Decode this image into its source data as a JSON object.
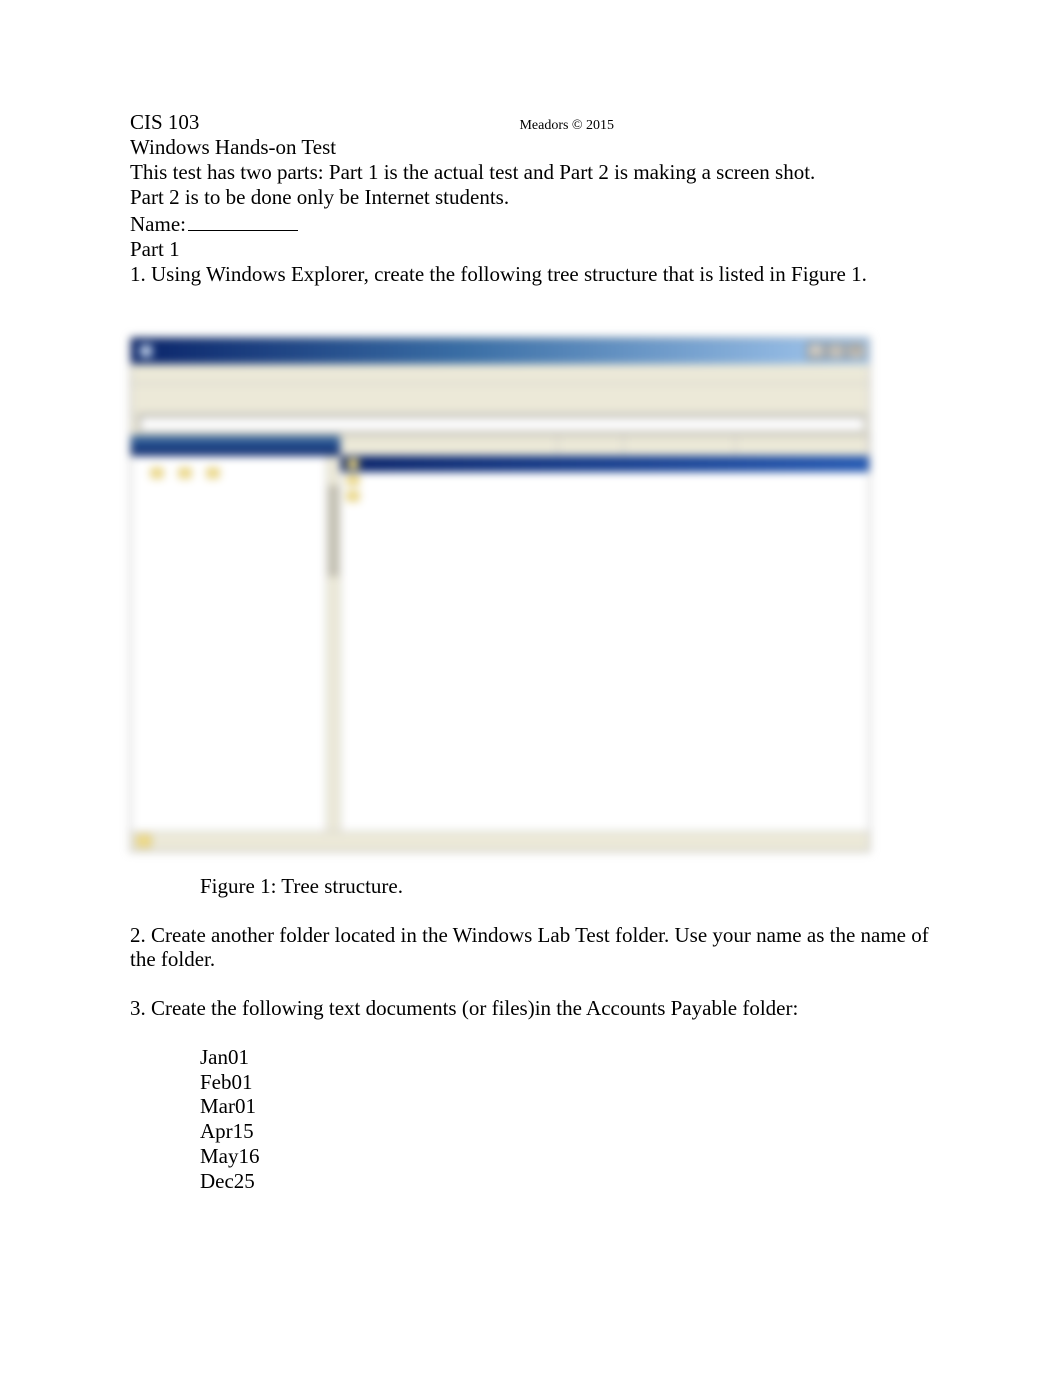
{
  "header": {
    "course": "CIS 103",
    "copyright": "Meadors © 2015",
    "title": "Windows Hands-on Test",
    "intro1": "This test has two parts: Part 1 is the actual test and Part 2 is making a screen shot.",
    "intro2": "Part 2 is to be done only be Internet students.",
    "name_label": "Name:",
    "part_label": "Part 1"
  },
  "questions": {
    "q1": "1.  Using Windows Explorer, create the following tree structure that is listed in Figure 1.",
    "caption": "Figure 1: Tree structure.",
    "q2": "2.  Create another folder located in the Windows Lab Test   folder.  Use your name as the name of the folder.",
    "q3": "3.   Create the following text documents (or files)in the Accounts Payable   folder:",
    "files": [
      "Jan01",
      "Feb01",
      "Mar01",
      "Apr15",
      "May16",
      "Dec25"
    ]
  },
  "explorer": {
    "title": "",
    "menubar": [
      "",
      "",
      "",
      "",
      "",
      ""
    ],
    "toolbar": [
      "",
      "",
      ""
    ],
    "address_label": "",
    "folders_header": "",
    "columns": {
      "name": "",
      "size": "",
      "type": "",
      "modified": ""
    },
    "tree": [
      "",
      "",
      "",
      "",
      "",
      "",
      "",
      "",
      "",
      "",
      "",
      "",
      "",
      "",
      "",
      "",
      "",
      ""
    ],
    "rows": [
      {
        "name": "",
        "type": "",
        "modified": "",
        "selected": true
      },
      {
        "name": "",
        "type": "",
        "modified": "",
        "selected": false
      },
      {
        "name": "",
        "type": "",
        "modified": "",
        "selected": false
      }
    ],
    "status": ""
  },
  "win_buttons": {
    "min": "_",
    "max": "□",
    "close": "X"
  }
}
